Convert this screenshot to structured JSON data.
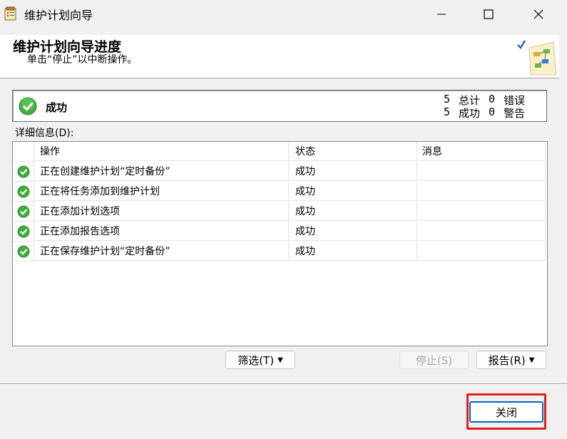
{
  "window": {
    "title": "维护计划向导",
    "icons": {
      "app": "wizard-app-icon",
      "minimize": "minimize-icon",
      "maximize": "maximize-icon",
      "close": "close-icon"
    }
  },
  "header": {
    "title": "维护计划向导进度",
    "subtitle": "单击“停止”以中断操作。",
    "icon": "wizard-graphic-icon"
  },
  "summary": {
    "status": "成功",
    "status_icon": "success-check-icon",
    "total_count": "5",
    "total_label": "总计",
    "error_count": "0",
    "error_label": "错误",
    "success_count": "5",
    "success_label": "成功",
    "warning_count": "0",
    "warning_label": "警告"
  },
  "details": {
    "label": "详细信息(D):",
    "columns": {
      "action": "操作",
      "status": "状态",
      "message": "消息"
    },
    "rows": [
      {
        "action": "正在创建维护计划“定时备份”",
        "status": "成功",
        "message": ""
      },
      {
        "action": "正在将任务添加到维护计划",
        "status": "成功",
        "message": ""
      },
      {
        "action": "正在添加计划选项",
        "status": "成功",
        "message": ""
      },
      {
        "action": "正在添加报告选项",
        "status": "成功",
        "message": ""
      },
      {
        "action": "正在保存维护计划“定时备份”",
        "status": "成功",
        "message": ""
      }
    ]
  },
  "buttons": {
    "filter": "筛选(T)",
    "stop": "停止(S)",
    "report": "报告(R)",
    "close": "关闭"
  },
  "colors": {
    "success_green": "#3fae3f",
    "accent": "#0067c0",
    "highlight_frame": "#e02020"
  }
}
